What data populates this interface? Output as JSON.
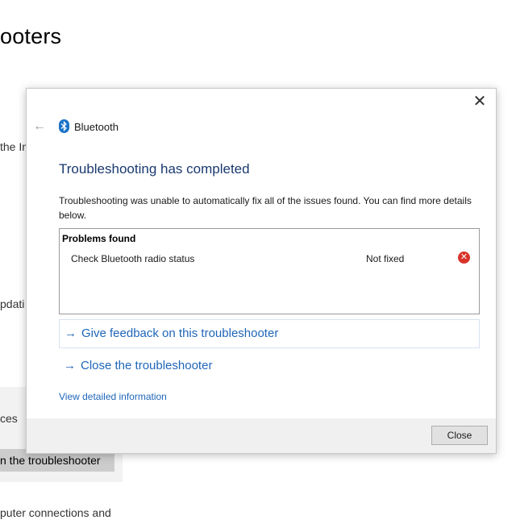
{
  "background": {
    "title": "ooters",
    "text_line1": "the In",
    "text_line2": "pdati",
    "text_line3": "ces",
    "run_button": "n the troubleshooter",
    "text_line4": "puter connections and"
  },
  "dialog": {
    "back_icon": "back-arrow-icon",
    "close_icon": "close-icon",
    "app_name": "Bluetooth",
    "heading": "Troubleshooting has completed",
    "description": "Troubleshooting was unable to automatically fix all of the issues found. You can find more details below.",
    "problems": {
      "header": "Problems found",
      "items": [
        {
          "name": "Check Bluetooth radio status",
          "status": "Not fixed",
          "status_icon": "error-icon"
        }
      ]
    },
    "links": {
      "feedback": "Give feedback on this troubleshooter",
      "close_troubleshooter": "Close the troubleshooter",
      "detailed_info": "View detailed information"
    },
    "close_button": "Close"
  },
  "colors": {
    "link": "#1f66b8",
    "heading": "#1b3a70",
    "error": "#d9322b",
    "bluetooth": "#1a73c8"
  }
}
